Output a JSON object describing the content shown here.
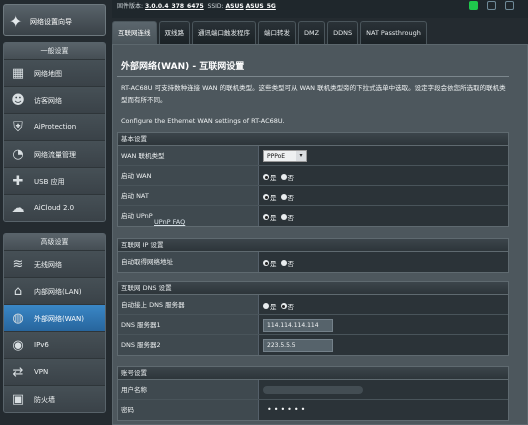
{
  "topbar": {
    "firmware_label": "固件版本:",
    "firmware_value": "3.0.0.4_378_6475",
    "ssid_label": "SSID:",
    "ssid_1": "ASUS",
    "ssid_2": "ASUS_5G"
  },
  "sidebar": {
    "qis_label": "网络设置向导",
    "general_header": "一般设置",
    "general": [
      {
        "label": "网络地图",
        "icon": "network-map-icon"
      },
      {
        "label": "访客网络",
        "icon": "guest-network-icon"
      },
      {
        "label": "AiProtection",
        "icon": "aiprotection-icon"
      },
      {
        "label": "网络流量管理",
        "icon": "traffic-manager-icon"
      },
      {
        "label": "USB 应用",
        "icon": "usb-icon"
      },
      {
        "label": "AiCloud 2.0",
        "icon": "aicloud-icon"
      }
    ],
    "advanced_header": "高级设置",
    "advanced": [
      {
        "label": "无线网络",
        "icon": "wireless-icon"
      },
      {
        "label": "内部网络(LAN)",
        "icon": "lan-icon"
      },
      {
        "label": "外部网络(WAN)",
        "icon": "wan-icon"
      },
      {
        "label": "IPv6",
        "icon": "ipv6-icon"
      },
      {
        "label": "VPN",
        "icon": "vpn-icon"
      },
      {
        "label": "防火墙",
        "icon": "firewall-icon"
      }
    ]
  },
  "tabs": [
    "互联网连线",
    "双线路",
    "通讯端口触发程序",
    "端口转发",
    "DMZ",
    "DDNS",
    "NAT Passthrough"
  ],
  "page": {
    "title": "外部网络(WAN) - 互联网设置",
    "description": "RT-AC68U 可支持数种连接 WAN 的联机类型。这些类型可从 WAN 联机类型旁的下拉式选单中选取。设定字段会依您所选取的联机类型而有所不同。",
    "configure_text": "Configure the Ethernet WAN settings of RT-AC68U."
  },
  "basic": {
    "header": "基本设置",
    "wan_type_label": "WAN 联机类型",
    "wan_type_value": "PPPoE",
    "enable_wan_label": "启动 WAN",
    "enable_nat_label": "启动 NAT",
    "enable_upnp_label": "启动 UPnP",
    "upnp_faq": "UPnP FAQ",
    "yes": "是",
    "no": "否"
  },
  "ip_settings": {
    "header": "互联网 IP 设置",
    "auto_ip_label": "自动取得网络地址"
  },
  "dns": {
    "header": "互联网 DNS 设置",
    "auto_dns_label": "自动接上 DNS 服务器",
    "dns1_label": "DNS 服务器1",
    "dns1_value": "114.114.114.114",
    "dns2_label": "DNS 服务器2",
    "dns2_value": "223.5.5.5"
  },
  "account": {
    "header": "账号设置",
    "username_label": "用户名称",
    "password_label": "密码",
    "password_mask": "••••••"
  },
  "colors": {
    "accent": "#2f7dbd",
    "panel": "#4d575d",
    "status_green": "#1fc84c"
  }
}
